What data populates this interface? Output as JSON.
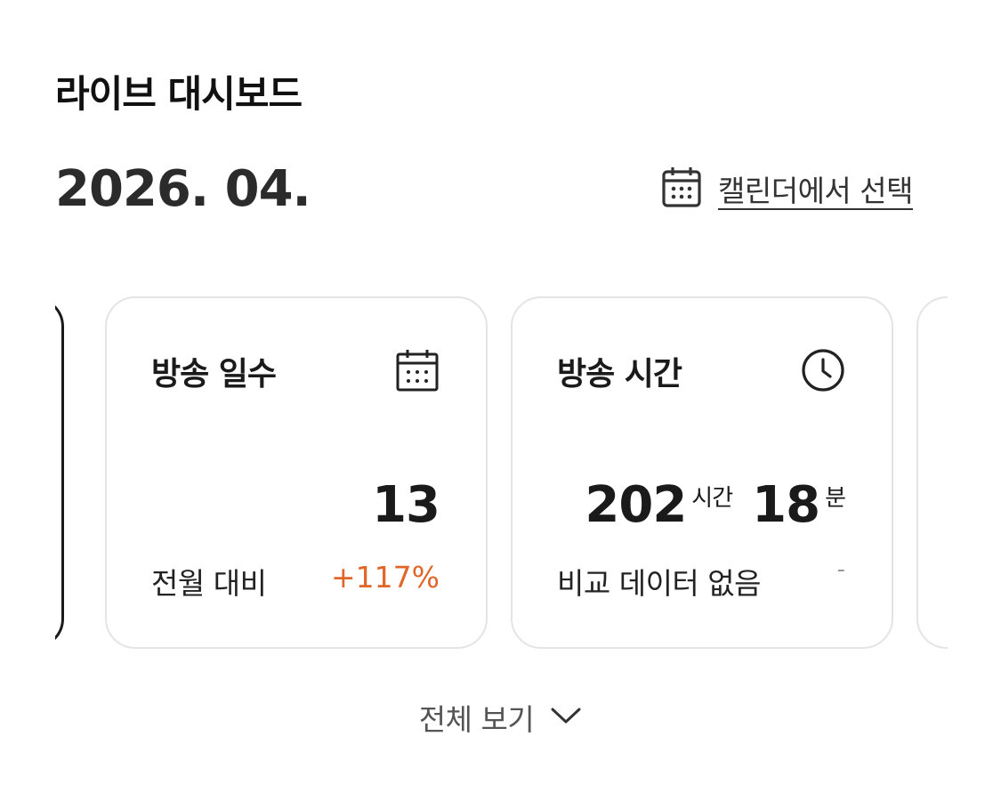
{
  "header": {
    "title": "라이브 대시보드"
  },
  "period": {
    "month": "2026. 04.",
    "calendar_link": "캘린더에서 선택",
    "calendar_icon": "calendar-icon"
  },
  "cards": [
    {
      "title": "방송 일수",
      "icon": "calendar-icon",
      "value": "13",
      "compare_label": "전월 대비",
      "compare_value": "+117%",
      "compare_color": "#e0662a"
    },
    {
      "title": "방송 시간",
      "icon": "clock-icon",
      "hours": "202",
      "hours_unit": "시간",
      "minutes": "18",
      "minutes_unit": "분",
      "compare_label": "비교 데이터 없음",
      "compare_value": "-"
    }
  ],
  "footer": {
    "view_all": "전체 보기",
    "view_all_icon": "chevron-down-icon"
  }
}
